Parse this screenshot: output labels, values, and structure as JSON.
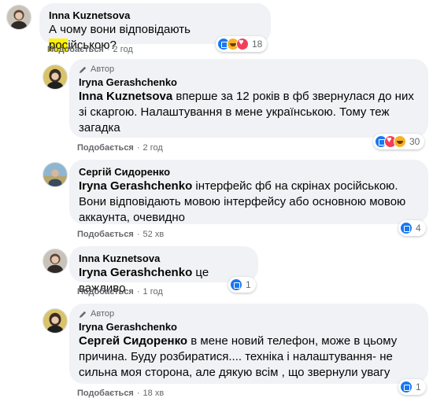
{
  "comments": [
    {
      "name": "Inna Kuznetsova",
      "text_pre": "А чому вони відповідають ",
      "text_hl": "рос",
      "text_post": "ійською?",
      "like_label": "Подобається",
      "time": "2 год",
      "reaction_count": "18"
    },
    {
      "badge": "Автор",
      "name": "Iryna Gerashchenko",
      "mention": "Inna Kuznetsova",
      "text": " вперше за 12 років в фб звернулася до них зі скаргою. Налаштування в мене українською. Тому теж загадка",
      "like_label": "Подобається",
      "time": "2 год",
      "reaction_count": "30"
    },
    {
      "name": "Сергій Сидоренко",
      "mention": "Iryna Gerashchenko",
      "text": " інтерфейс фб на скрінах російською. Вони відповідають мовою інтерфейсу або основною мовою аккаунта, очевидно",
      "like_label": "Подобається",
      "time": "52 хв",
      "reaction_count": "4"
    },
    {
      "name": "Inna Kuznetsova",
      "mention": "Iryna Gerashchenko",
      "text": " це важливо",
      "like_label": "Подобається",
      "time": "1 год",
      "reaction_count": "1"
    },
    {
      "badge": "Автор",
      "name": "Iryna Gerashchenko",
      "mention": "Сергей Сидоренко",
      "text": " в мене новий телефон, може в цьому причина. Буду розбиратися.... техніка і налаштування- не сильна моя сторона, але дякую всім , що звернули увагу",
      "like_label": "Подобається",
      "time": "18 хв",
      "reaction_count": "1"
    }
  ],
  "dot": "·",
  "colors": {
    "bubble": "#f0f2f5",
    "meta": "#65676b",
    "like_blue": "#1877f2",
    "highlight": "#fff200"
  }
}
